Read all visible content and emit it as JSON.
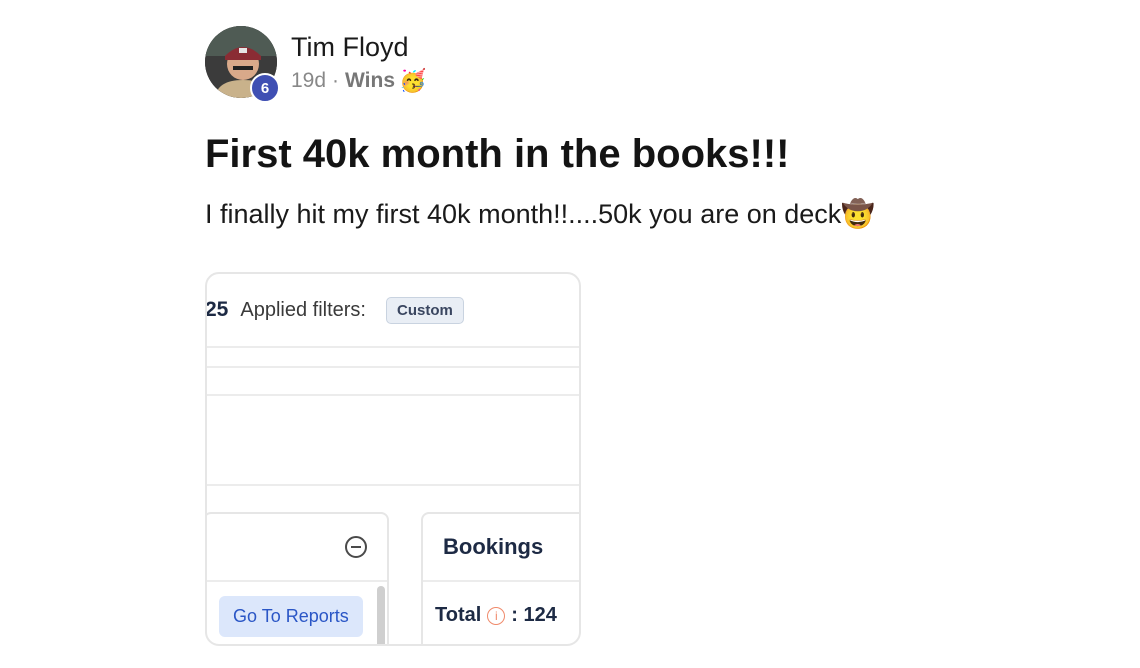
{
  "author": {
    "name": "Tim Floyd",
    "level": "6"
  },
  "meta": {
    "time_ago": "19d",
    "separator": "·",
    "category": "Wins",
    "category_emoji": "🥳"
  },
  "post": {
    "title": "First 40k month in the books!!!",
    "body": "I finally hit my first 40k month!!....50k you are on deck",
    "body_emoji": "🤠"
  },
  "attachment": {
    "filters_prefix": "25",
    "filters_label": "Applied filters:",
    "filter_chip": "Custom",
    "left_card_button": "Go To Reports",
    "right_card_title": "Bookings",
    "total_label": "Total",
    "total_info_glyph": "i",
    "total_value": ": 124"
  },
  "colors": {
    "level_badge": "#3f4fb3",
    "link_blue": "#2a56c6",
    "info_orange": "#f08a6b"
  }
}
